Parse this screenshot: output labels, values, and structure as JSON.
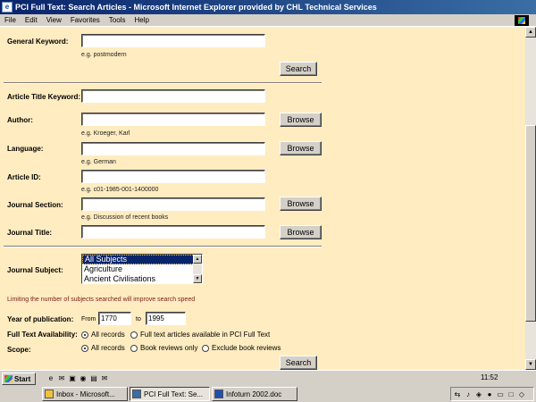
{
  "window": {
    "title": "PCI Full Text: Search Articles - Microsoft Internet Explorer provided by CHL Technical Services"
  },
  "menu": [
    "File",
    "Edit",
    "View",
    "Favorites",
    "Tools",
    "Help"
  ],
  "form": {
    "general_keyword": {
      "label": "General Keyword:",
      "value": "",
      "hint": "e.g. postmodern"
    },
    "search_button": "Search",
    "article_title_keyword": {
      "label": "Article Title Keyword:",
      "value": ""
    },
    "author": {
      "label": "Author:",
      "value": "",
      "hint": "e.g. Kroeger, Karl",
      "button": "Browse"
    },
    "language": {
      "label": "Language:",
      "value": "",
      "hint": "e.g. German",
      "button": "Browse"
    },
    "article_id": {
      "label": "Article ID:",
      "value": "",
      "hint": "e.g. c01-1985-001-1400000"
    },
    "journal_section": {
      "label": "Journal Section:",
      "value": "",
      "hint": "e.g. Discussion of recent books",
      "button": "Browse"
    },
    "journal_title": {
      "label": "Journal Title:",
      "value": "",
      "button": "Browse"
    },
    "journal_subject": {
      "label": "Journal Subject:",
      "options": [
        "All Subjects",
        "Agriculture",
        "Ancient Civilisations"
      ],
      "selected": "All Subjects"
    },
    "limit_note": "Limiting the number of subjects searched will improve search speed",
    "year_of_publication": {
      "label": "Year of publication:",
      "from_label": "From",
      "from": "1770",
      "to_label": "to",
      "to": "1995"
    },
    "full_text_availability": {
      "label": "Full Text Availability:",
      "options": [
        "All records",
        "Full text articles available in PCI Full Text"
      ],
      "selected": "All records"
    },
    "scope": {
      "label": "Scope:",
      "options": [
        "All records",
        "Book reviews only",
        "Exclude book reviews"
      ],
      "selected": "All records"
    },
    "search_button_bottom": "Search"
  },
  "taskbar": {
    "start_label": "Start",
    "clock": "11:52",
    "tasks": [
      {
        "label": "Inbox - Microsoft...",
        "icon": "outlook-icon"
      },
      {
        "label": "PCI Full Text: Se...",
        "icon": "ie-icon"
      },
      {
        "label": "Infoturn 2002.doc",
        "icon": "word-icon"
      }
    ]
  }
}
